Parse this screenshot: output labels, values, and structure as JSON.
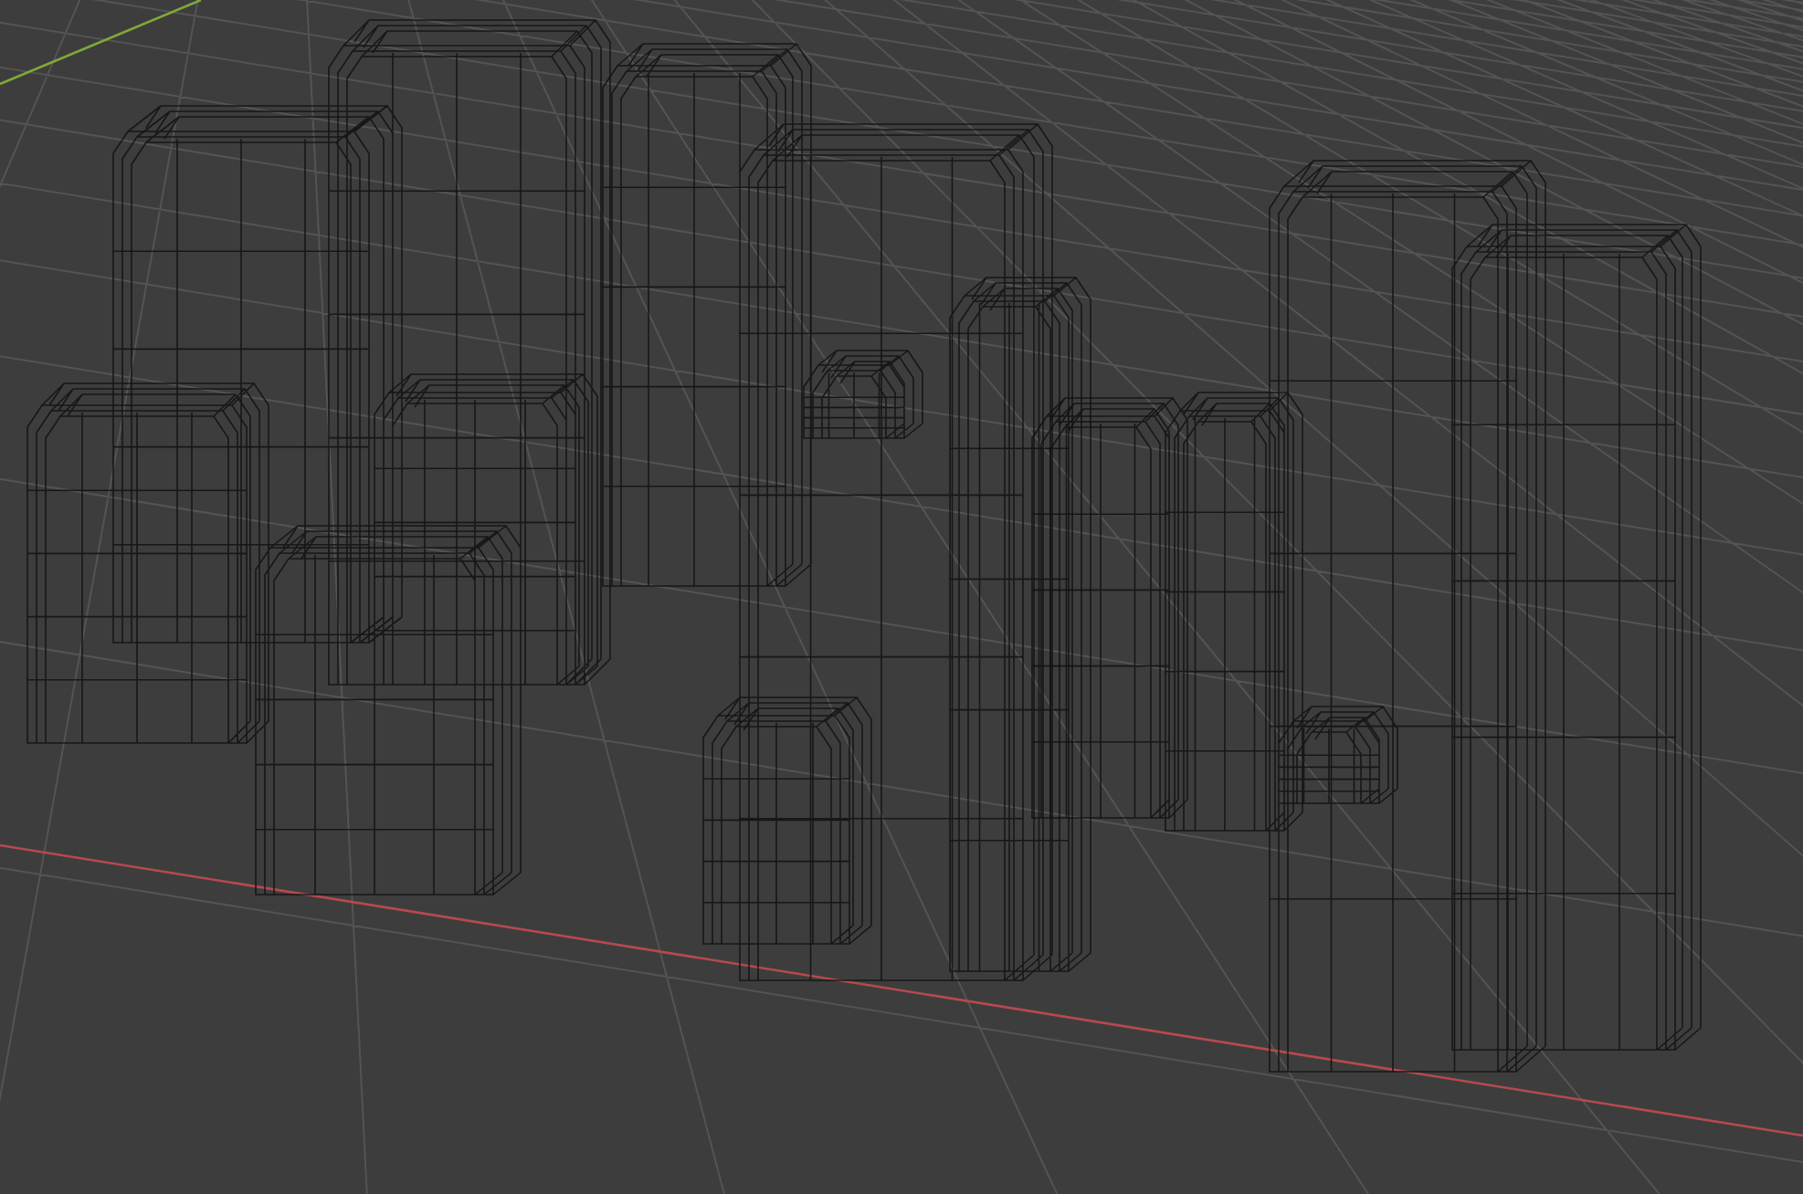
{
  "viewport": {
    "objects": [
      {
        "kind": "cactus"
      },
      {
        "kind": "cactus"
      },
      {
        "kind": "cactus"
      }
    ]
  }
}
